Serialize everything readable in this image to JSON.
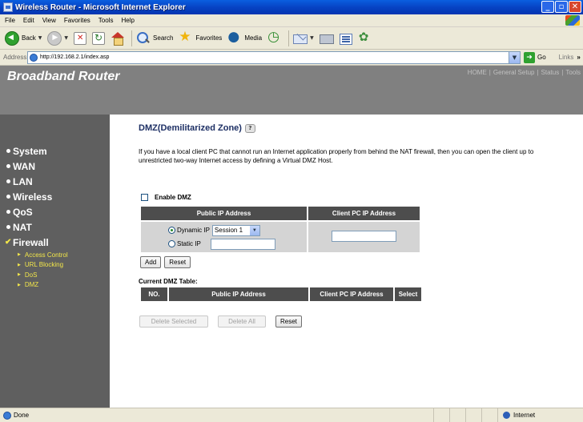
{
  "window": {
    "title": "Wireless Router - Microsoft Internet Explorer"
  },
  "menu": [
    "File",
    "Edit",
    "View",
    "Favorites",
    "Tools",
    "Help"
  ],
  "toolbar": {
    "back": "Back",
    "search": "Search",
    "favorites": "Favorites",
    "media": "Media"
  },
  "address": {
    "label": "Address",
    "url": "http://192.168.2.1/index.asp",
    "go": "Go",
    "links": "Links",
    "links_more": "»"
  },
  "page": {
    "brand": "Broadband Router",
    "topnav": [
      "HOME",
      "General Setup",
      "Status",
      "Tools"
    ],
    "sidebar": {
      "items": [
        {
          "label": "System"
        },
        {
          "label": "WAN"
        },
        {
          "label": "LAN"
        },
        {
          "label": "Wireless"
        },
        {
          "label": "QoS"
        },
        {
          "label": "NAT"
        },
        {
          "label": "Firewall"
        }
      ],
      "subitems": [
        "Access Control",
        "URL Blocking",
        "DoS",
        "DMZ"
      ]
    },
    "title": "DMZ(Demilitarized Zone)",
    "description": "If you have a local client PC that cannot run an Internet application properly from behind the NAT firewall, then you can open the client up to unrestricted two-way Internet access by defining a Virtual DMZ Host.",
    "enable_label": "Enable DMZ",
    "enable_checked": false,
    "table": {
      "col_public": "Public IP Address",
      "col_client": "Client PC IP Address",
      "dynamic_label": "Dynamic IP",
      "dynamic_selected": true,
      "session_value": "Session 1",
      "static_label": "Static IP",
      "static_value": "",
      "client_value": ""
    },
    "buttons": {
      "add": "Add",
      "reset": "Reset",
      "delete_selected": "Delete Selected",
      "delete_all": "Delete All",
      "reset2": "Reset"
    },
    "current_table": {
      "title": "Current DMZ Table:",
      "headers": [
        "NO.",
        "Public IP Address",
        "Client PC IP Address",
        "Select"
      ]
    }
  },
  "status": {
    "text": "Done",
    "zone": "Internet"
  },
  "colors": {
    "header_bg": "#808080",
    "sidebar_bg": "#5f5f5f",
    "subnav_text": "#f2e64a",
    "title_text": "#1d2f64",
    "table_header": "#4d4d4d"
  }
}
